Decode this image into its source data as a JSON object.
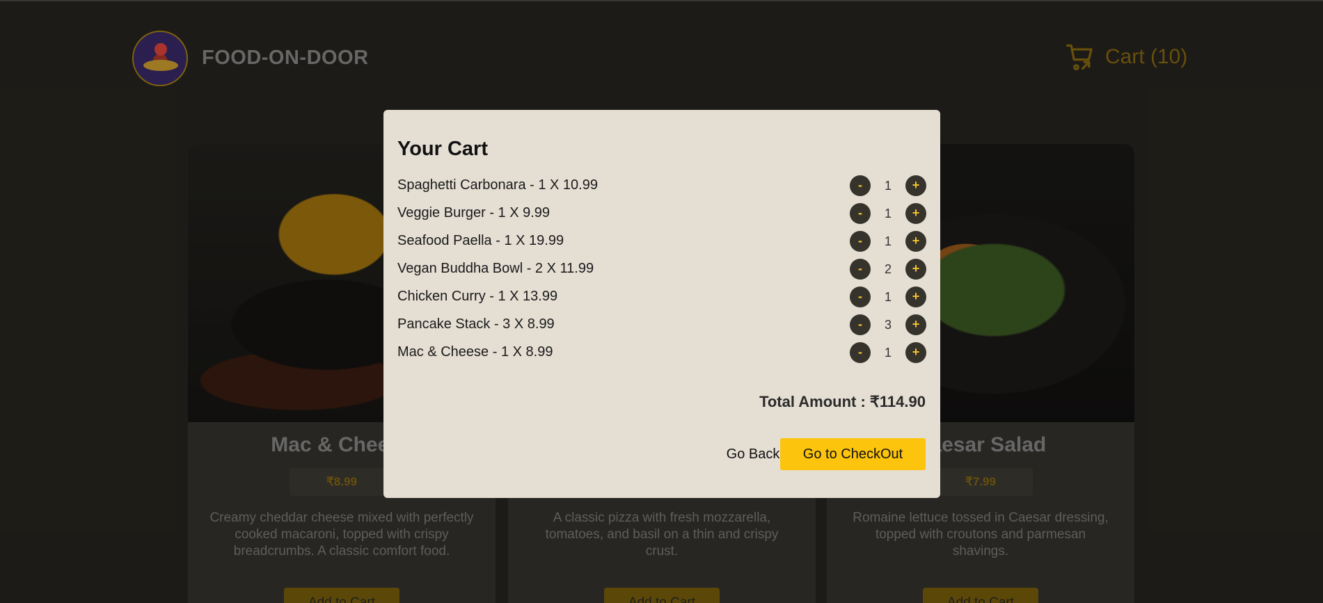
{
  "header": {
    "brand": "FOOD-ON-DOOR",
    "cart_label": "Cart (10)"
  },
  "menu": [
    {
      "title": "Mac & Cheese",
      "price": "₹8.99",
      "description": "Creamy cheddar cheese mixed with perfectly cooked macaroni, topped with crispy breadcrumbs. A classic comfort food.",
      "button": "Add to Cart"
    },
    {
      "title": "",
      "price": "",
      "description": "A classic pizza with fresh mozzarella, tomatoes, and basil on a thin and crispy crust.",
      "button": "Add to Cart"
    },
    {
      "title": "Caesar Salad",
      "price": "₹7.99",
      "description": "Romaine lettuce tossed in Caesar dressing, topped with croutons and parmesan shavings.",
      "button": "Add to Cart"
    }
  ],
  "modal": {
    "title": "Your Cart",
    "minus": "-",
    "plus": "+",
    "items": [
      {
        "label": "Spaghetti Carbonara - 1 X 10.99",
        "qty": "1"
      },
      {
        "label": "Veggie Burger - 1 X 9.99",
        "qty": "1"
      },
      {
        "label": "Seafood Paella - 1 X 19.99",
        "qty": "1"
      },
      {
        "label": "Vegan Buddha Bowl - 2 X 11.99",
        "qty": "2"
      },
      {
        "label": "Chicken Curry - 1 X 13.99",
        "qty": "1"
      },
      {
        "label": "Pancake Stack - 3 X 8.99",
        "qty": "3"
      },
      {
        "label": "Mac & Cheese - 1 X 8.99",
        "qty": "1"
      }
    ],
    "total": "Total Amount : ₹114.90",
    "back_label": "Go Back",
    "checkout_label": "Go to CheckOut"
  }
}
